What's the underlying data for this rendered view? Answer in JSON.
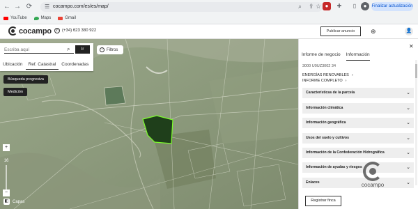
{
  "browser": {
    "url": "cocampo.com/es/es/map/",
    "update_label": "Finalizar actualización",
    "bookmarks": [
      {
        "label": "YouTube",
        "color": "#ff0000"
      },
      {
        "label": "Maps",
        "color": "#34a853"
      },
      {
        "label": "Gmail",
        "color": "#ea4335"
      }
    ]
  },
  "site": {
    "logo_text": "cocampo",
    "phone": "(+34) 623 380 922",
    "publish_label": "Publicar anuncio"
  },
  "map": {
    "search_placeholder": "Escriba aquí",
    "search_button": "Ir",
    "tabs": [
      "Ubicación",
      "Ref. Catastral",
      "Coordenadas"
    ],
    "active_tab": "Ref. Catastral",
    "filters_label": "Filtros",
    "progressive_search_label": "Búsqueda progresiva",
    "measure_label": "Medición",
    "zoom_level": "16",
    "zoom_in": "+",
    "zoom_out": "−",
    "layers_label": "Capas",
    "parcel_color": "#1f3f1b",
    "parcel_outline": "#7cff2a"
  },
  "panel": {
    "tabs": [
      "Informe de negocio",
      "Información"
    ],
    "active_tab": "Información",
    "ref_number": "3000 U0UZ3002 34",
    "links": [
      "ENERGÍAS RENOVABLES",
      "INFORME COMPLETO"
    ],
    "sections": [
      "Características de la parcela",
      "Información climática",
      "Información geográfica",
      "Usos del suelo y cultivos",
      "Información de la Confederación Hidrográfica",
      "Información de ayudas y riesgos",
      "Enlaces"
    ],
    "watermark_text": "cocampo",
    "register_label": "Registrar finca"
  }
}
